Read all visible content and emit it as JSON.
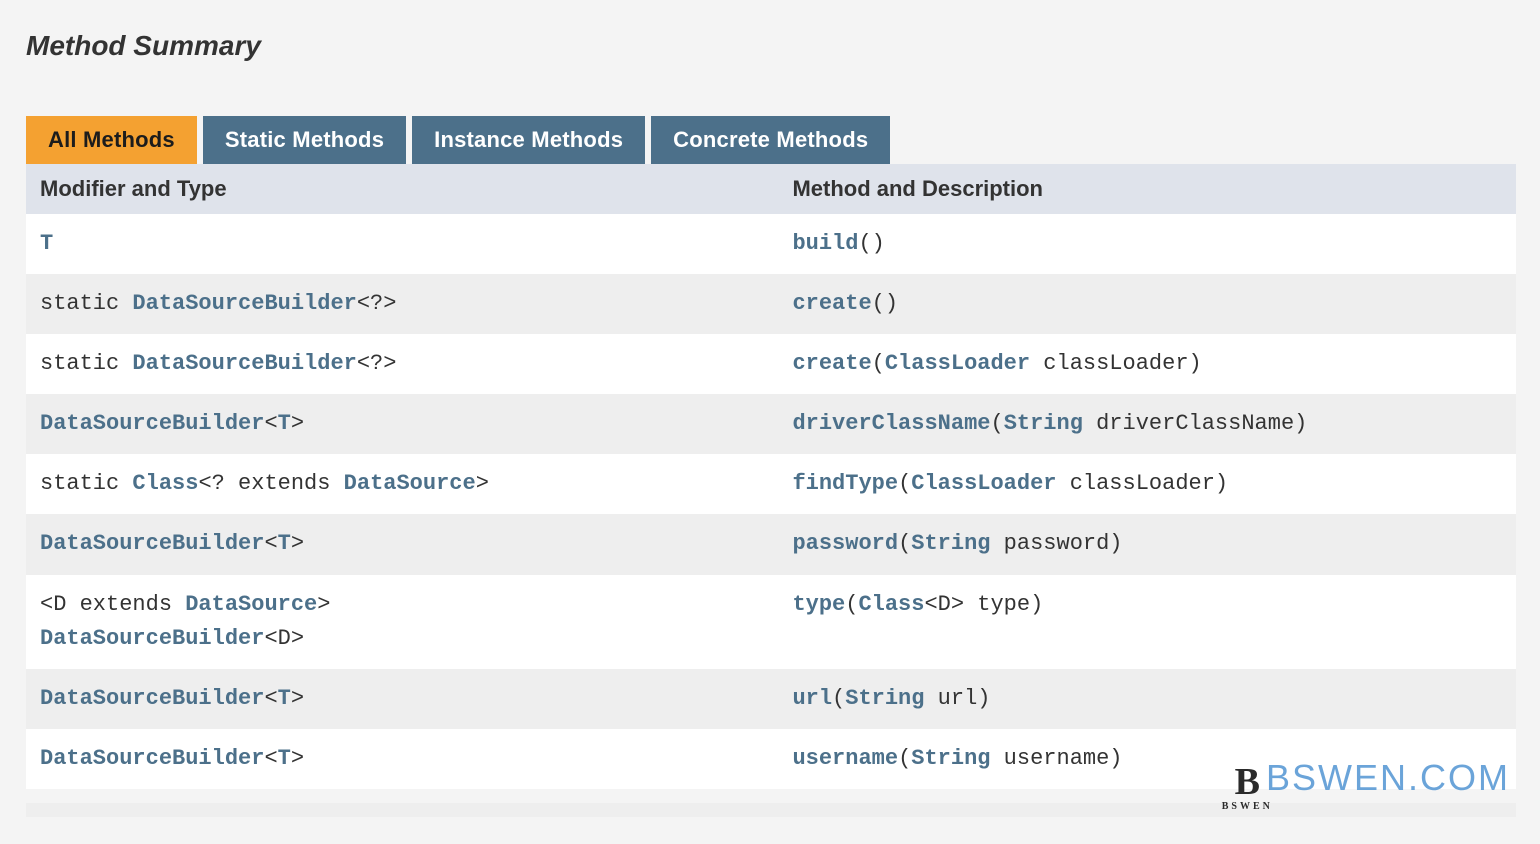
{
  "title": "Method Summary",
  "tabs": [
    {
      "label": "All Methods",
      "active": true
    },
    {
      "label": "Static Methods",
      "active": false
    },
    {
      "label": "Instance Methods",
      "active": false
    },
    {
      "label": "Concrete Methods",
      "active": false
    }
  ],
  "columns": {
    "modifier": "Modifier and Type",
    "method": "Method and Description"
  },
  "rows": [
    {
      "modifier": [
        {
          "t": "T",
          "cls": "link"
        }
      ],
      "method": [
        {
          "t": "build",
          "cls": "link"
        },
        {
          "t": "()",
          "cls": "plain"
        }
      ]
    },
    {
      "modifier": [
        {
          "t": "static ",
          "cls": "plain"
        },
        {
          "t": "DataSourceBuilder",
          "cls": "link"
        },
        {
          "t": "<?>",
          "cls": "plain"
        }
      ],
      "method": [
        {
          "t": "create",
          "cls": "link"
        },
        {
          "t": "()",
          "cls": "plain"
        }
      ]
    },
    {
      "modifier": [
        {
          "t": "static ",
          "cls": "plain"
        },
        {
          "t": "DataSourceBuilder",
          "cls": "link"
        },
        {
          "t": "<?>",
          "cls": "plain"
        }
      ],
      "method": [
        {
          "t": "create",
          "cls": "link"
        },
        {
          "t": "(",
          "cls": "plain"
        },
        {
          "t": "ClassLoader",
          "cls": "link"
        },
        {
          "t": " classLoader)",
          "cls": "plain"
        }
      ]
    },
    {
      "modifier": [
        {
          "t": "DataSourceBuilder",
          "cls": "link"
        },
        {
          "t": "<",
          "cls": "plain"
        },
        {
          "t": "T",
          "cls": "link"
        },
        {
          "t": ">",
          "cls": "plain"
        }
      ],
      "method": [
        {
          "t": "driverClassName",
          "cls": "link"
        },
        {
          "t": "(",
          "cls": "plain"
        },
        {
          "t": "String",
          "cls": "link"
        },
        {
          "t": " driverClassName)",
          "cls": "plain"
        }
      ]
    },
    {
      "modifier": [
        {
          "t": "static ",
          "cls": "plain"
        },
        {
          "t": "Class",
          "cls": "link"
        },
        {
          "t": "<? extends ",
          "cls": "plain"
        },
        {
          "t": "DataSource",
          "cls": "link"
        },
        {
          "t": ">",
          "cls": "plain"
        }
      ],
      "method": [
        {
          "t": "findType",
          "cls": "link"
        },
        {
          "t": "(",
          "cls": "plain"
        },
        {
          "t": "ClassLoader",
          "cls": "link"
        },
        {
          "t": " classLoader)",
          "cls": "plain"
        }
      ]
    },
    {
      "modifier": [
        {
          "t": "DataSourceBuilder",
          "cls": "link"
        },
        {
          "t": "<",
          "cls": "plain"
        },
        {
          "t": "T",
          "cls": "link"
        },
        {
          "t": ">",
          "cls": "plain"
        }
      ],
      "method": [
        {
          "t": "password",
          "cls": "link"
        },
        {
          "t": "(",
          "cls": "plain"
        },
        {
          "t": "String",
          "cls": "link"
        },
        {
          "t": " password)",
          "cls": "plain"
        }
      ]
    },
    {
      "modifier": [
        {
          "t": "<D extends ",
          "cls": "plain"
        },
        {
          "t": "DataSource",
          "cls": "link"
        },
        {
          "t": ">",
          "cls": "plain"
        },
        {
          "t": "\n",
          "cls": "br"
        },
        {
          "t": "DataSourceBuilder",
          "cls": "link"
        },
        {
          "t": "<D>",
          "cls": "plain"
        }
      ],
      "method": [
        {
          "t": "type",
          "cls": "link"
        },
        {
          "t": "(",
          "cls": "plain"
        },
        {
          "t": "Class",
          "cls": "link"
        },
        {
          "t": "<D> type)",
          "cls": "plain"
        }
      ]
    },
    {
      "modifier": [
        {
          "t": "DataSourceBuilder",
          "cls": "link"
        },
        {
          "t": "<",
          "cls": "plain"
        },
        {
          "t": "T",
          "cls": "link"
        },
        {
          "t": ">",
          "cls": "plain"
        }
      ],
      "method": [
        {
          "t": "url",
          "cls": "link"
        },
        {
          "t": "(",
          "cls": "plain"
        },
        {
          "t": "String",
          "cls": "link"
        },
        {
          "t": " url)",
          "cls": "plain"
        }
      ]
    },
    {
      "modifier": [
        {
          "t": "DataSourceBuilder",
          "cls": "link"
        },
        {
          "t": "<",
          "cls": "plain"
        },
        {
          "t": "T",
          "cls": "link"
        },
        {
          "t": ">",
          "cls": "plain"
        }
      ],
      "method": [
        {
          "t": "username",
          "cls": "link"
        },
        {
          "t": "(",
          "cls": "plain"
        },
        {
          "t": "String",
          "cls": "link"
        },
        {
          "t": " username)",
          "cls": "plain"
        }
      ]
    }
  ],
  "watermark": {
    "logo_letter": "B",
    "logo_sub": "BSWEN",
    "text": "BSWEN.COM"
  }
}
